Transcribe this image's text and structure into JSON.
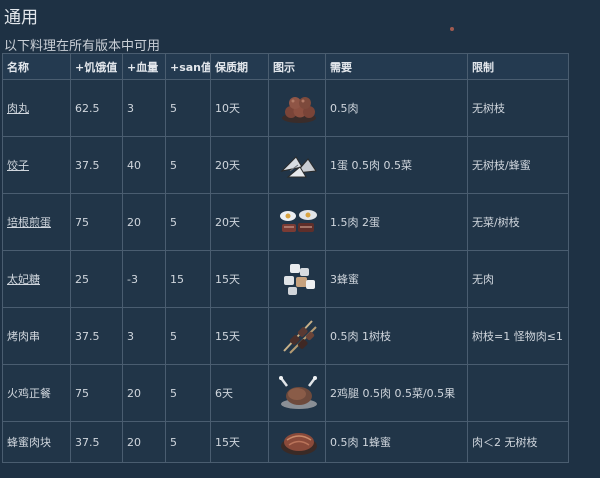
{
  "header": {
    "title": "通用",
    "subtitle": "以下料理在所有版本中可用"
  },
  "table": {
    "columns": [
      "名称",
      "+饥饿值",
      "+血量",
      "+san值",
      "保质期",
      "图示",
      "需要",
      "限制"
    ],
    "rows": [
      {
        "name": "肉丸",
        "linked": true,
        "hunger": "62.5",
        "health": "3",
        "sanity": "5",
        "shelf": "10天",
        "icon": "meatballs-icon",
        "needs": "0.5肉",
        "limit": "无树枝"
      },
      {
        "name": "饺子",
        "linked": true,
        "hunger": "37.5",
        "health": "40",
        "sanity": "5",
        "shelf": "20天",
        "icon": "pierogi-icon",
        "needs": "1蛋 0.5肉 0.5菜",
        "limit": "无树枝/蜂蜜"
      },
      {
        "name": "培根煎蛋",
        "linked": true,
        "hunger": "75",
        "health": "20",
        "sanity": "5",
        "shelf": "20天",
        "icon": "bacon-eggs-icon",
        "needs": "1.5肉 2蛋",
        "limit": "无菜/树枝"
      },
      {
        "name": "太妃糖",
        "linked": true,
        "hunger": "25",
        "health": "-3",
        "sanity": "15",
        "shelf": "15天",
        "icon": "taffy-icon",
        "needs": "3蜂蜜",
        "limit": "无肉"
      },
      {
        "name": "烤肉串",
        "linked": false,
        "hunger": "37.5",
        "health": "3",
        "sanity": "5",
        "shelf": "15天",
        "icon": "kabobs-icon",
        "needs": "0.5肉 1树枝",
        "limit": "树枝=1 怪物肉≤1"
      },
      {
        "name": "火鸡正餐",
        "linked": false,
        "hunger": "75",
        "health": "20",
        "sanity": "5",
        "shelf": "6天",
        "icon": "turkey-dinner-icon",
        "needs": "2鸡腿 0.5肉 0.5菜/0.5果",
        "limit": ""
      },
      {
        "name": "蜂蜜肉块",
        "linked": false,
        "hunger": "37.5",
        "health": "20",
        "sanity": "5",
        "shelf": "15天",
        "icon": "honey-ham-icon",
        "needs": "0.5肉 1蜂蜜",
        "limit": "肉＜2 无树枝"
      }
    ]
  }
}
